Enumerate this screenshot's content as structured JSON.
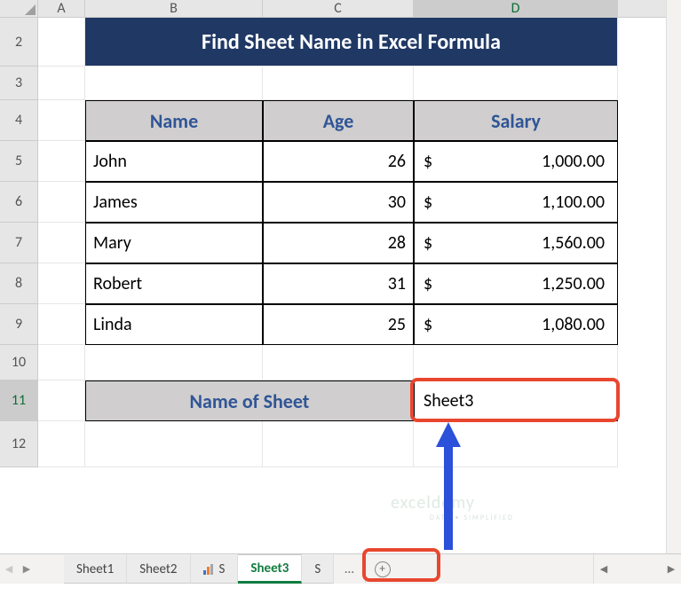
{
  "columns": {
    "A": "A",
    "B": "B",
    "C": "C",
    "D": "D"
  },
  "rows": [
    "2",
    "3",
    "4",
    "5",
    "6",
    "7",
    "8",
    "9",
    "10",
    "11",
    "12"
  ],
  "title": "Find Sheet Name in Excel Formula",
  "headers": {
    "name": "Name",
    "age": "Age",
    "salary": "Salary"
  },
  "chart_data": {
    "type": "table",
    "columns": [
      "Name",
      "Age",
      "Salary"
    ],
    "rows": [
      [
        "John",
        26,
        1000.0
      ],
      [
        "James",
        30,
        1100.0
      ],
      [
        "Mary",
        28,
        1560.0
      ],
      [
        "Robert",
        31,
        1250.0
      ],
      [
        "Linda",
        25,
        1080.0
      ]
    ],
    "currency": "$"
  },
  "data": [
    {
      "name": "John",
      "age": "26",
      "salary": "1,000.00"
    },
    {
      "name": "James",
      "age": "30",
      "salary": "1,100.00"
    },
    {
      "name": "Mary",
      "age": "28",
      "salary": "1,560.00"
    },
    {
      "name": "Robert",
      "age": "31",
      "salary": "1,250.00"
    },
    {
      "name": "Linda",
      "age": "25",
      "salary": "1,080.00"
    }
  ],
  "currency": "$",
  "label": "Name of Sheet",
  "result": "Sheet3",
  "tabs": {
    "sheet1": "Sheet1",
    "sheet2": "Sheet2",
    "sheet3": "Sheet3",
    "more": "…",
    "chart_prefix": "S"
  },
  "watermark": {
    "main": "exceldemy",
    "sub": "DATA • SIMPLIFIED"
  },
  "icons": {
    "left": "◀",
    "right": "▶",
    "plus": "+"
  }
}
